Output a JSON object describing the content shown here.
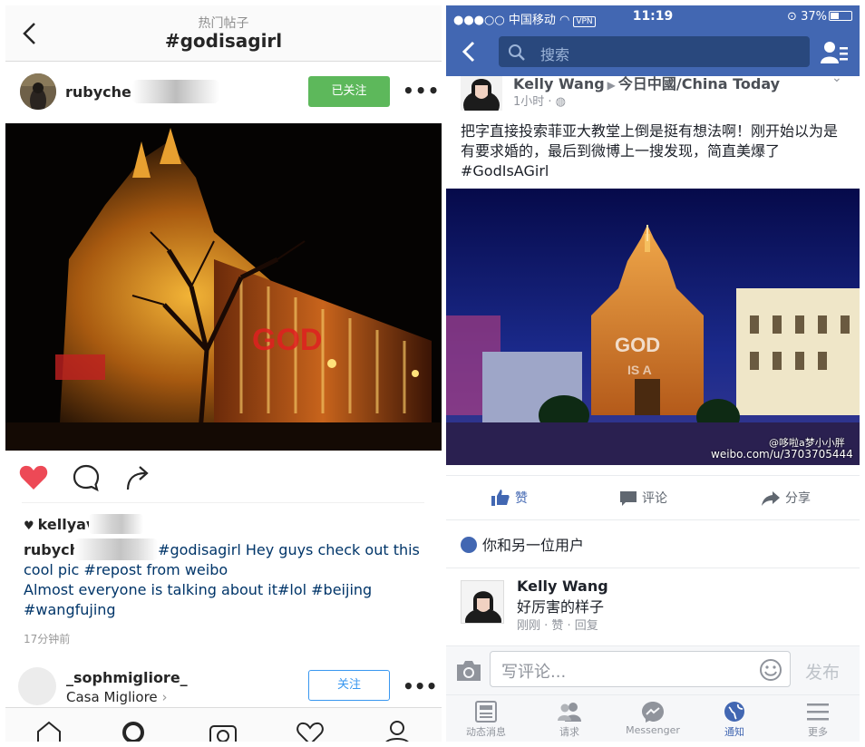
{
  "instagram": {
    "top_bar": {
      "subtitle": "热门帖子",
      "title": "#godisagirl"
    },
    "post": {
      "username": "rubycher",
      "follow_label": "已关注",
      "more_label": "•••",
      "likes_user": "kellyav",
      "caption_user": "rubych",
      "caption_text": "#godisagirl Hey guys check out this cool pic #repost from weibo",
      "caption_text_line2": "Almost everyone is talking about it#lol #beijing #wangfujing",
      "time": "17分钟前"
    },
    "suggestion": {
      "name": "_sophmigliore_",
      "subtitle": "Casa Migliore",
      "follow_label": "关注",
      "more_label": "•••"
    },
    "tabs": [
      "home-icon",
      "search-icon",
      "camera-icon",
      "heart-icon",
      "profile-icon"
    ]
  },
  "facebook": {
    "status_bar": {
      "carrier": "●●●○○ 中国移动",
      "vpn": "VPN",
      "time": "11:19",
      "battery": "37%"
    },
    "search_placeholder": "搜索",
    "post": {
      "author": "Kelly Wang",
      "page": "今日中國/China Today",
      "meta": "1小时 · ",
      "text": "把字直接投索菲亚大教堂上倒是挺有想法啊！刚开始以为是有要求婚的，最后到微博上一搜发现，简直美爆了 #GodIsAGirl",
      "watermark_user": "@哆啦a梦小小胖",
      "watermark_url": "weibo.com/u/3703705444"
    },
    "actions": {
      "like": "赞",
      "comment": "评论",
      "share": "分享"
    },
    "likers_text": "你和另一位用户",
    "comment": {
      "name": "Kelly Wang",
      "text": "好厉害的样子",
      "meta": "刚刚 · 赞 · 回复"
    },
    "composer": {
      "placeholder": "写评论...",
      "post_label": "发布"
    },
    "tabs": [
      {
        "label": "动态消息",
        "icon": "news-feed-icon",
        "active": false
      },
      {
        "label": "请求",
        "icon": "friend-requests-icon",
        "active": false
      },
      {
        "label": "Messenger",
        "icon": "messenger-icon",
        "active": false
      },
      {
        "label": "通知",
        "icon": "notifications-globe-icon",
        "active": true
      },
      {
        "label": "更多",
        "icon": "menu-icon",
        "active": false
      }
    ],
    "accent_color": "#4267b2"
  }
}
